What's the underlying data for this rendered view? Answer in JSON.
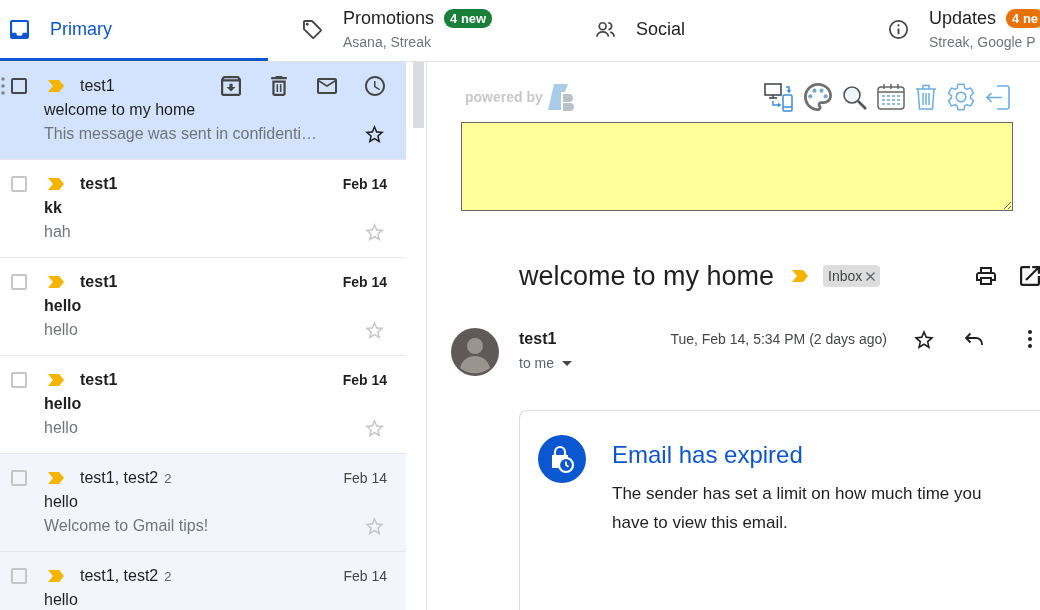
{
  "tabs": [
    {
      "label": "Primary",
      "selected": true
    },
    {
      "label": "Promotions",
      "selected": false,
      "badge": {
        "text": "4 new",
        "color": "#188038"
      },
      "subtitle": "Asana, Streak"
    },
    {
      "label": "Social",
      "selected": false
    },
    {
      "label": "Updates",
      "selected": false,
      "badge": {
        "text": "4 ne",
        "color": "#e8710a"
      },
      "subtitle": "Streak, Google P"
    }
  ],
  "mail_list": {
    "rows": [
      {
        "sender": "test1",
        "subject": "welcome to my home",
        "snippet": "This message was sent in confidenti…",
        "selected": true,
        "unread": false,
        "checked": false,
        "important": true,
        "starred": false
      },
      {
        "sender": "test1",
        "date": "Feb 14",
        "subject": "kk",
        "snippet": "hah",
        "selected": false,
        "unread": true,
        "checked": false,
        "important": true,
        "starred": false
      },
      {
        "sender": "test1",
        "date": "Feb 14",
        "subject": "hello",
        "snippet": "hello",
        "selected": false,
        "unread": true,
        "checked": false,
        "important": true,
        "starred": false
      },
      {
        "sender": "test1",
        "date": "Feb 14",
        "subject": "hello",
        "snippet": "hello",
        "selected": false,
        "unread": true,
        "checked": false,
        "important": true,
        "starred": false
      },
      {
        "sender": "test1, test2",
        "count": "2",
        "date": "Feb 14",
        "subject": "hello",
        "snippet": "Welcome to Gmail tips!",
        "selected": false,
        "unread": false,
        "checked": false,
        "important": true,
        "starred": false
      },
      {
        "sender": "test1, test2",
        "count": "2",
        "date": "Feb 14",
        "subject": "hello",
        "selected": false,
        "unread": false,
        "checked": false,
        "important": true
      }
    ]
  },
  "extension": {
    "powered_by": "powered by"
  },
  "message": {
    "subject": "welcome to my home",
    "important": true,
    "labels": [
      {
        "text": "Inbox"
      }
    ],
    "sender": "test1",
    "recipient": "to me",
    "date": "Tue, Feb 14, 5:34 PM (2 days ago)",
    "starred": false
  },
  "expired_notice": {
    "title": "Email has expired",
    "text": "The sender has set a limit on how much time you have to view this email."
  }
}
